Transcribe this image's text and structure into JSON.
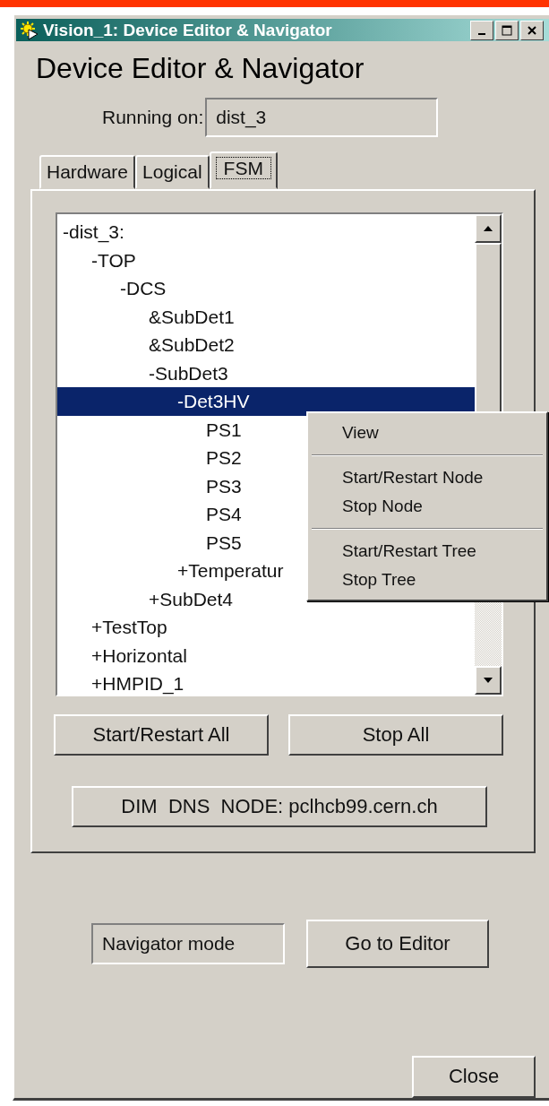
{
  "window": {
    "title": "Vision_1: Device Editor & Navigator"
  },
  "heading": "Device Editor & Navigator",
  "running_on": {
    "label": "Running on:",
    "value": "dist_3"
  },
  "tabs": [
    {
      "label": "Hardware",
      "selected": false
    },
    {
      "label": "Logical",
      "selected": false
    },
    {
      "label": "FSM",
      "selected": true
    }
  ],
  "tree": [
    {
      "label": "-dist_3:",
      "selected": false,
      "children": [
        {
          "label": "-TOP",
          "selected": false,
          "children": [
            {
              "label": "-DCS",
              "selected": false,
              "children": [
                {
                  "label": "&SubDet1",
                  "selected": false
                },
                {
                  "label": "&SubDet2",
                  "selected": false
                },
                {
                  "label": "-SubDet3",
                  "selected": false,
                  "children": [
                    {
                      "label": "-Det3HV",
                      "selected": true,
                      "children": [
                        {
                          "label": "PS1",
                          "selected": false
                        },
                        {
                          "label": "PS2",
                          "selected": false
                        },
                        {
                          "label": "PS3",
                          "selected": false
                        },
                        {
                          "label": "PS4",
                          "selected": false
                        },
                        {
                          "label": "PS5",
                          "selected": false
                        }
                      ]
                    },
                    {
                      "label": "+Temperatur",
                      "selected": false
                    }
                  ]
                },
                {
                  "label": "+SubDet4",
                  "selected": false
                }
              ]
            }
          ]
        },
        {
          "label": "+TestTop",
          "selected": false
        },
        {
          "label": "+Horizontal",
          "selected": false
        },
        {
          "label": "+HMPID_1",
          "selected": false
        }
      ]
    }
  ],
  "context_menu": [
    [
      "View"
    ],
    [
      "Start/Restart Node",
      "Stop Node"
    ],
    [
      "Start/Restart Tree",
      "Stop Tree"
    ]
  ],
  "buttons": [
    "Start/Restart All",
    "Stop All"
  ],
  "dns_button": "DIM  DNS  NODE: pclhcb99.cern.ch",
  "mode_field": {
    "value": "Navigator mode"
  },
  "editor_button": "Go to Editor",
  "close_button": "Close"
}
